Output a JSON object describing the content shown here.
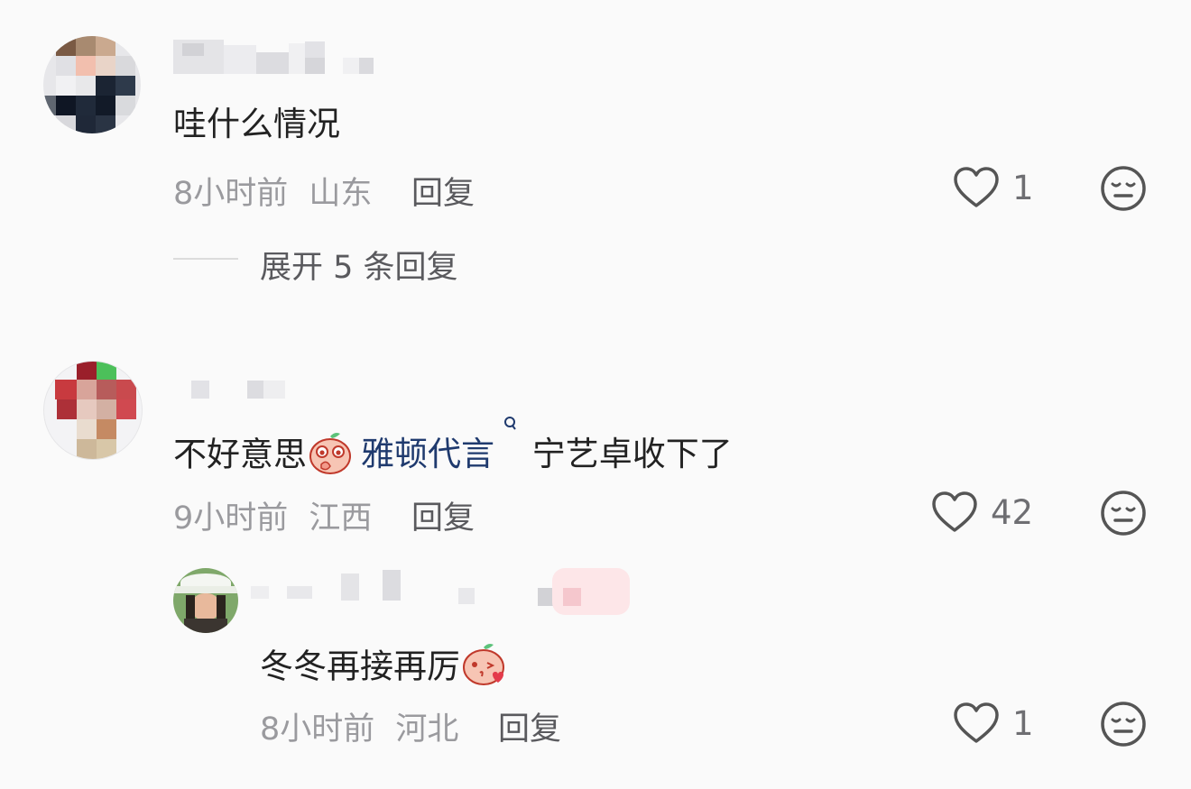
{
  "comments": [
    {
      "text": "哇什么情况",
      "time": "8小时前",
      "location": "山东",
      "reply_label": "回复",
      "likes": "1",
      "expand_label": "展开 5 条回复"
    },
    {
      "text_before": "不好意思",
      "mention": "雅顿代言",
      "text_after": "宁艺卓收下了",
      "time": "9小时前",
      "location": "江西",
      "reply_label": "回复",
      "likes": "42",
      "reply": {
        "text": "冬冬再接再厉",
        "time": "8小时前",
        "location": "河北",
        "reply_label": "回复",
        "likes": "1"
      }
    }
  ],
  "colors": {
    "mention": "#1f3a6e",
    "meta": "#9a9a9e",
    "text": "#222222"
  }
}
